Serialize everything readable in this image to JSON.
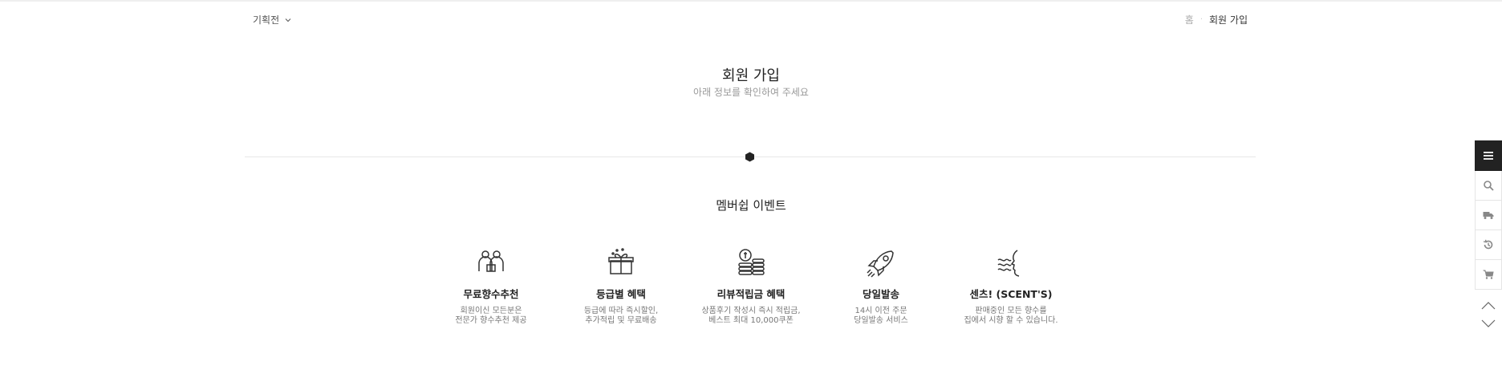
{
  "header": {
    "category_label": "기획전",
    "breadcrumb": {
      "home": "홈",
      "separator": "·",
      "current": "회원 가입"
    }
  },
  "page": {
    "title": "회원 가입",
    "subtitle": "아래 정보를 확인하여 주세요"
  },
  "membership": {
    "title": "멤버쉽 이벤트",
    "benefits": [
      {
        "icon": "people-icon",
        "title": "무료향수추천",
        "desc_line1": "회원이신 모든분은",
        "desc_line2": "전문가 향수추천 제공"
      },
      {
        "icon": "gift-box-icon",
        "title": "등급별 혜택",
        "desc_line1": "등급에 따라 즉시할인,",
        "desc_line2": "추가적립 및 무료배송"
      },
      {
        "icon": "coins-icon",
        "title": "리뷰적립금 혜택",
        "desc_line1": "상품후기 작성시 즉시 적립금,",
        "desc_line2": "베스트 최대 10,000쿠폰"
      },
      {
        "icon": "rocket-icon",
        "title": "당일발송",
        "desc_line1": "14시 이전 주문",
        "desc_line2": "당일발송 서비스"
      },
      {
        "icon": "scent-face-icon",
        "title": "센츠! (SCENT'S)",
        "desc_line1": "판매중인 모든 향수를",
        "desc_line2": "집에서 시향 할 수 있습니다."
      }
    ]
  },
  "quickbar": {
    "items": [
      "menu-icon",
      "search-icon",
      "truck-icon",
      "history-icon",
      "cart-icon"
    ]
  },
  "colors": {
    "accent_dark": "#222222",
    "muted_text": "#999999",
    "divider": "#e8e8e8"
  }
}
